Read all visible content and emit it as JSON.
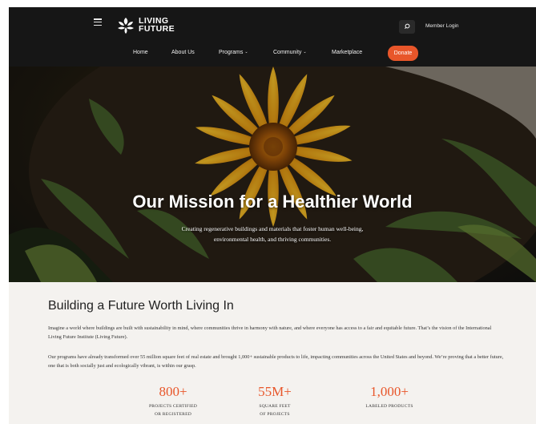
{
  "header": {
    "logo_line1": "LIVING",
    "logo_line2": "FUTURE",
    "member_login": "Member Login",
    "nav": [
      {
        "label": "Home"
      },
      {
        "label": "About Us"
      },
      {
        "label": "Programs"
      },
      {
        "label": "Community"
      },
      {
        "label": "Marketplace"
      }
    ],
    "donate": "Donate",
    "icons": {
      "menu": "hamburger-icon",
      "search": "search-icon",
      "dropdown": "chevron-down-icon"
    }
  },
  "hero": {
    "title": "Our Mission for a Healthier World",
    "subtitle": "Creating regenerative buildings and materials that foster human well-being, environmental health, and thriving communities."
  },
  "main": {
    "heading": "Building a Future Worth Living In",
    "para1": "Imagine a world where buildings are built with sustainability in mind, where communities thrive in harmony with nature, and where everyone has access to a fair and equitable future. That’s the vision of the International Living Future Institute (Living Future).",
    "para2": "Our programs have already transformed over 55 million square feet of real estate and brought 1,000+ sustainable products to life, impacting communities across the United States and beyond. We’re proving that a better future, one that is both socially just and ecologically vibrant, is within our grasp.",
    "stats": [
      {
        "value": "800+",
        "label_line1": "PROJECTS CERTIFIED",
        "label_line2": "OR REGISTERED"
      },
      {
        "value": "55M+",
        "label_line1": "SQUARE FEET",
        "label_line2": "OF PROJECTS"
      },
      {
        "value": "1,000+",
        "label_line1": "LABELED PRODUCTS",
        "label_line2": ""
      }
    ]
  },
  "colors": {
    "header_bg": "#161616",
    "accent": "#e8562a",
    "page_bg": "#f4f2ef"
  }
}
